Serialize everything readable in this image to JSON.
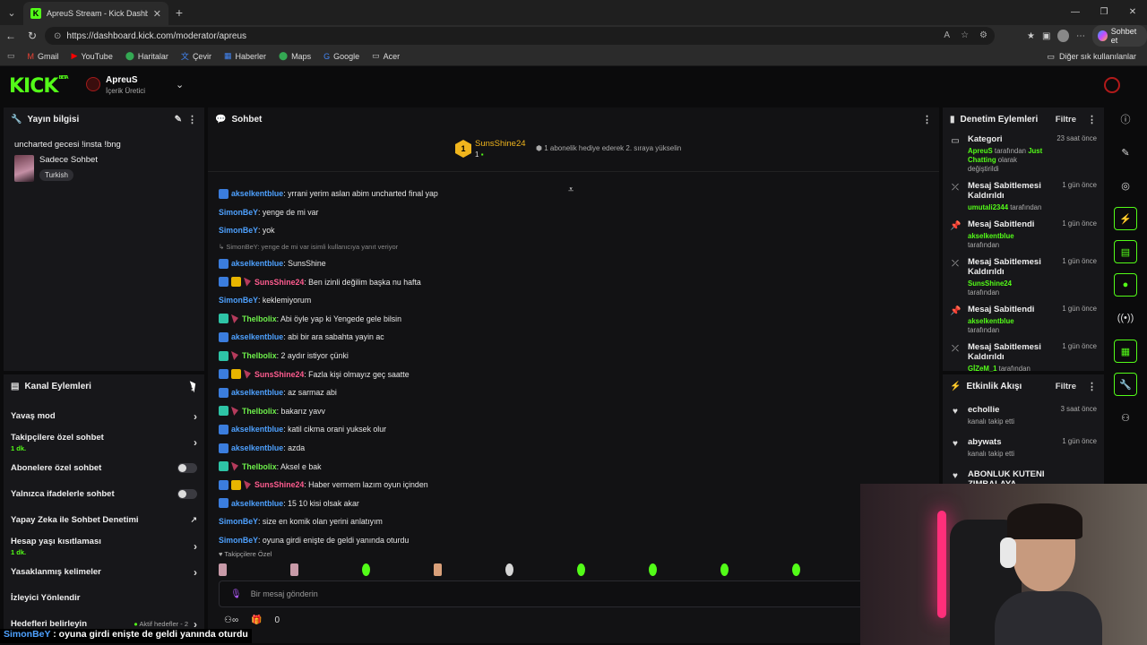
{
  "browser": {
    "tab_title": "ApreuS Stream - Kick Dashboard",
    "url": "https://dashboard.kick.com/moderator/apreus",
    "chat_button": "Sohbet et",
    "bookmarks": [
      "Gmail",
      "YouTube",
      "Haritalar",
      "Çevir",
      "Haberler",
      "Maps",
      "Google",
      "Acer"
    ],
    "bookmarks_right": "Diğer sık kullanılanlar"
  },
  "header": {
    "logo": "KICK",
    "logo_sup": "BETA",
    "channel_name": "ApreuS",
    "channel_role": "İçerik Üretici"
  },
  "stream_info": {
    "title": "Yayın bilgisi",
    "stream_title": "uncharted gecesi !insta !bng",
    "category": "Sadece Sohbet",
    "tag": "Turkish"
  },
  "channel_actions": {
    "title": "Kanal Eylemleri",
    "items": [
      {
        "label": "Yavaş mod",
        "sub": "",
        "control": "chevron"
      },
      {
        "label": "Takipçilere özel sohbet",
        "sub": "1 dk.",
        "control": "chevron"
      },
      {
        "label": "Abonelere özel sohbet",
        "sub": "",
        "control": "toggle"
      },
      {
        "label": "Yalnızca ifadelerle sohbet",
        "sub": "",
        "control": "toggle"
      },
      {
        "label": "Yapay Zeka ile Sohbet Denetimi",
        "sub": "",
        "control": "external"
      },
      {
        "label": "Hesap yaşı kısıtlaması",
        "sub": "1 dk.",
        "control": "chevron"
      },
      {
        "label": "Yasaklanmış kelimeler",
        "sub": "",
        "control": "chevron"
      },
      {
        "label": "İzleyici Yönlendir",
        "sub": "",
        "control": "none"
      },
      {
        "label": "Hedefleri belirleyin",
        "sub": "",
        "control": "chevron"
      }
    ],
    "goals_status": "Aktif hedefler - 2"
  },
  "chat": {
    "title": "Sohbet",
    "pinned": {
      "rank": "1",
      "user": "SunsShine24",
      "count": "1",
      "message": "1 abonelik hediye ederek 2. sıraya yükselin"
    },
    "messages": [
      {
        "type": "msg",
        "badges": [
          "b"
        ],
        "user": "akselkentblue",
        "color": "c-blue",
        "text": ": yrrani yerim aslan abim uncharted final yap"
      },
      {
        "type": "msg",
        "badges": [],
        "user": "SimonBeY",
        "color": "c-blue",
        "text": ": yenge de mi var"
      },
      {
        "type": "msg",
        "badges": [],
        "user": "SimonBeY",
        "color": "c-blue",
        "text": ": yok"
      },
      {
        "type": "reply",
        "text": "↳ SimonBeY: yenge de mi var isimli kullanıcıya yanıt veriyor"
      },
      {
        "type": "msg",
        "badges": [
          "b"
        ],
        "user": "akselkentblue",
        "color": "c-blue",
        "text": ": SunsShine"
      },
      {
        "type": "msg",
        "badges": [
          "b",
          "y",
          "h"
        ],
        "user": "SunsShine24",
        "color": "c-pink",
        "text": ": Ben izinli değilim başka nu hafta"
      },
      {
        "type": "msg",
        "badges": [],
        "user": "SimonBeY",
        "color": "c-blue",
        "text": ": keklemiyorum"
      },
      {
        "type": "msg",
        "badges": [
          "g",
          "h"
        ],
        "user": "Thelbolix",
        "color": "c-green",
        "text": ": Abi öyle yap ki Yengede gele bilsin"
      },
      {
        "type": "msg",
        "badges": [
          "b"
        ],
        "user": "akselkentblue",
        "color": "c-blue",
        "text": ": abi bir ara sabahta yayin ac"
      },
      {
        "type": "msg",
        "badges": [
          "g",
          "h"
        ],
        "user": "Thelbolix",
        "color": "c-green",
        "text": ": 2 aydır istiyor çünki"
      },
      {
        "type": "msg",
        "badges": [
          "b",
          "y",
          "h"
        ],
        "user": "SunsShine24",
        "color": "c-pink",
        "text": ": Fazla kişi olmayız geç saatte"
      },
      {
        "type": "msg",
        "badges": [
          "b"
        ],
        "user": "akselkentblue",
        "color": "c-blue",
        "text": ": az sarmaz abi"
      },
      {
        "type": "msg",
        "badges": [
          "g",
          "h"
        ],
        "user": "Thelbolix",
        "color": "c-green",
        "text": ": bakarız yavv"
      },
      {
        "type": "msg",
        "badges": [
          "b"
        ],
        "user": "akselkentblue",
        "color": "c-blue",
        "text": ": katil cikma orani yuksek olur"
      },
      {
        "type": "msg",
        "badges": [
          "b"
        ],
        "user": "akselkentblue",
        "color": "c-blue",
        "text": ": azda"
      },
      {
        "type": "msg",
        "badges": [
          "g",
          "h"
        ],
        "user": "Thelbolix",
        "color": "c-green",
        "text": ": Aksel e bak"
      },
      {
        "type": "msg",
        "badges": [
          "b",
          "y",
          "h"
        ],
        "user": "SunsShine24",
        "color": "c-pink",
        "text": ": Haber vermem lazım oyun içinden"
      },
      {
        "type": "msg",
        "badges": [
          "b"
        ],
        "user": "akselkentblue",
        "color": "c-blue",
        "text": ": 15 10 kisi olsak akar"
      },
      {
        "type": "msg",
        "badges": [],
        "user": "SimonBeY",
        "color": "c-blue",
        "text": ": size en komik olan yerini anlatıyım"
      },
      {
        "type": "msg",
        "badges": [],
        "user": "SimonBeY",
        "color": "c-blue",
        "text": ": oyuna girdi enişte de geldi yanında oturdu"
      }
    ],
    "emote_section": "Takipçilere Özel",
    "input_placeholder": "Bir mesaj gönderin",
    "footer_count": "0"
  },
  "mod_actions": {
    "title": "Denetim Eylemleri",
    "filter": "Filtre",
    "items": [
      {
        "icon": "▭",
        "title": "Kategori",
        "time": "23 saat önce",
        "actor": "ApreuS",
        "mid": " tarafından ",
        "target": "Just Chatting",
        "tail": " olarak değiştirildi"
      },
      {
        "icon": "⤫",
        "title": "Mesaj Sabitlemesi Kaldırıldı",
        "time": "1 gün önce",
        "actor": "umutali2344",
        "mid": " tarafından",
        "target": "",
        "tail": ""
      },
      {
        "icon": "📌",
        "title": "Mesaj Sabitlendi",
        "time": "1 gün önce",
        "actor": "akselkentblue",
        "mid": " tarafından",
        "target": "",
        "tail": ""
      },
      {
        "icon": "⤫",
        "title": "Mesaj Sabitlemesi Kaldırıldı",
        "time": "1 gün önce",
        "actor": "SunsShine24",
        "mid": " tarafından",
        "target": "",
        "tail": ""
      },
      {
        "icon": "📌",
        "title": "Mesaj Sabitlendi",
        "time": "1 gün önce",
        "actor": "akselkentblue",
        "mid": " tarafından",
        "target": "",
        "tail": ""
      },
      {
        "icon": "⤫",
        "title": "Mesaj Sabitlemesi Kaldırıldı",
        "time": "1 gün önce",
        "actor": "GİZeM_1",
        "mid": " tarafından",
        "target": "",
        "tail": ""
      }
    ]
  },
  "activity": {
    "title": "Etkinlik Akışı",
    "filter": "Filtre",
    "items": [
      {
        "name": "echollie",
        "desc": "kanalı takip etti",
        "time": "3 saat önce"
      },
      {
        "name": "abywats",
        "desc": "kanalı takip etti",
        "time": "1 gün önce"
      },
      {
        "name": "ABONLUK KUTENI ZIMBALAYA",
        "desc": "",
        "time": ""
      }
    ]
  },
  "subtitle": {
    "user": "SimonBeY",
    "text": " : oyuna girdi enişte de geldi yanında oturdu"
  },
  "colors": {
    "accent": "#53fc18",
    "panel": "#17171a",
    "background": "#0b0b0c"
  }
}
